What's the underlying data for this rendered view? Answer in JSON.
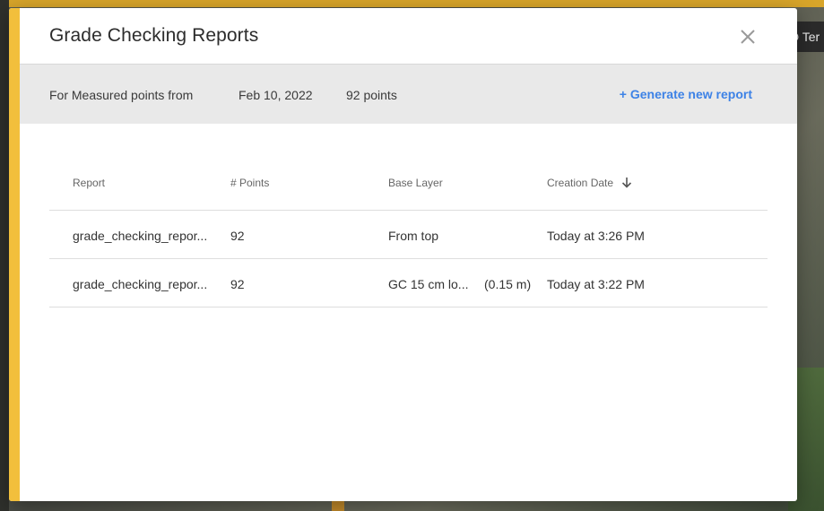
{
  "dialog": {
    "title": "Grade Checking Reports",
    "close_icon": "close-icon"
  },
  "info": {
    "from_label": "For Measured points from",
    "date": "Feb 10, 2022",
    "points": "92 points",
    "generate_label": "+ Generate new report"
  },
  "table": {
    "headers": {
      "report": "Report",
      "points": "# Points",
      "base_layer": "Base Layer",
      "creation_date": "Creation Date"
    },
    "sort_icon": "arrow-down-icon",
    "rows": [
      {
        "report": "grade_checking_repor...",
        "points": "92",
        "base_layer": "From top",
        "base_extra": "",
        "creation_date": "Today at 3:26 PM"
      },
      {
        "report": "grade_checking_repor...",
        "points": "92",
        "base_layer": "GC 15 cm lo...",
        "base_extra": "(0.15 m)",
        "creation_date": "Today at 3:22 PM"
      }
    ]
  },
  "background": {
    "chip_text": "D Ter"
  },
  "colors": {
    "accent": "#f2bf3c",
    "link": "#3d82e6",
    "info_bar": "#e9e9e9"
  }
}
